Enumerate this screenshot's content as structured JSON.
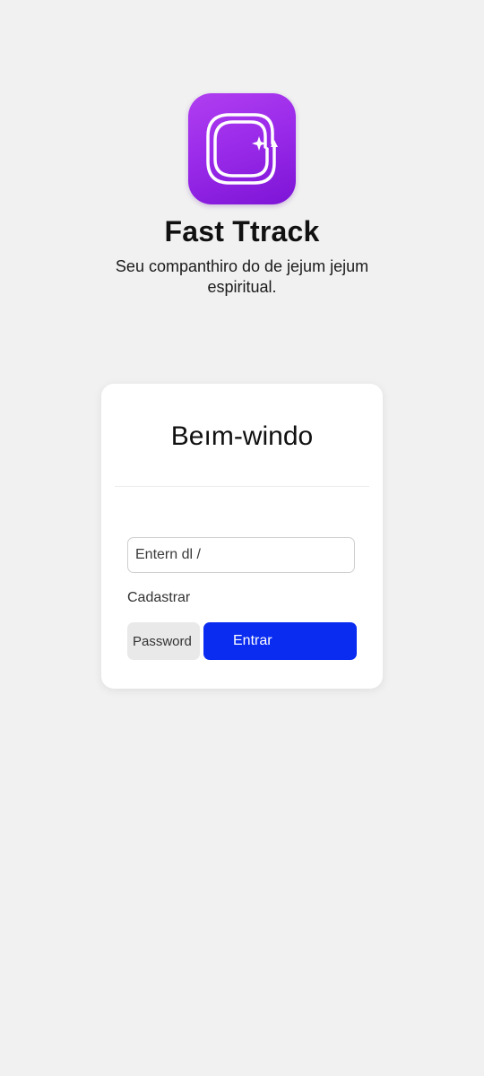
{
  "app": {
    "icon": "app-logo-icon",
    "name": "Fast Ttrack",
    "tagline": "Seu companthiro do de jejum jejum espiritual.",
    "brand_color": "#9b2bea"
  },
  "login_card": {
    "title": "Beım-windo",
    "email_placeholder": "Entern dl /",
    "signup_label": "Cadastrar",
    "password_placeholder": "Password",
    "submit_label": "Entrar",
    "submit_color": "#0a2cf0"
  }
}
